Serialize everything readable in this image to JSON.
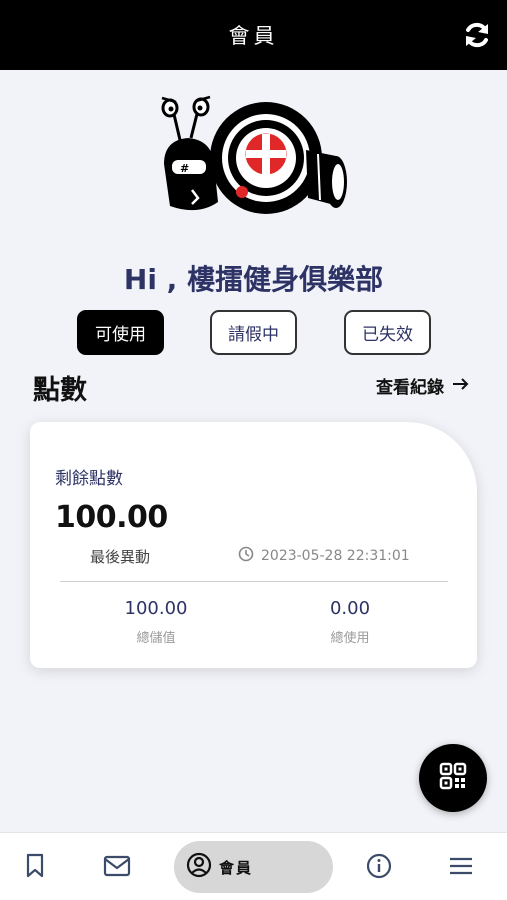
{
  "header": {
    "title": "會員",
    "refresh_icon": "refresh-icon"
  },
  "greeting": "Hi , 樓擂健身俱樂部",
  "status_tabs": [
    {
      "label": "可使用",
      "active": true
    },
    {
      "label": "請假中",
      "active": false
    },
    {
      "label": "已失效",
      "active": false
    }
  ],
  "points": {
    "heading": "點數",
    "history_link": "查看紀錄",
    "card": {
      "label": "剩餘點數",
      "value": "100.00",
      "last_change_label": "最後異動",
      "last_change_time": "2023-05-28 22:31:01",
      "stats": [
        {
          "value": "100.00",
          "label": "總儲值"
        },
        {
          "value": "0.00",
          "label": "總使用"
        }
      ]
    }
  },
  "fab": {
    "icon": "qr-code-icon"
  },
  "bottom_nav": {
    "items": [
      {
        "icon": "bookmark-icon"
      },
      {
        "icon": "mail-icon"
      },
      {
        "icon": "user-circle-icon",
        "label": "會員",
        "active": true
      },
      {
        "icon": "info-icon"
      },
      {
        "icon": "menu-icon"
      }
    ]
  },
  "colors": {
    "accent_text": "#2e3366",
    "topbar": "#000000",
    "background": "#f1f3f8",
    "logo_red": "#e12828"
  }
}
